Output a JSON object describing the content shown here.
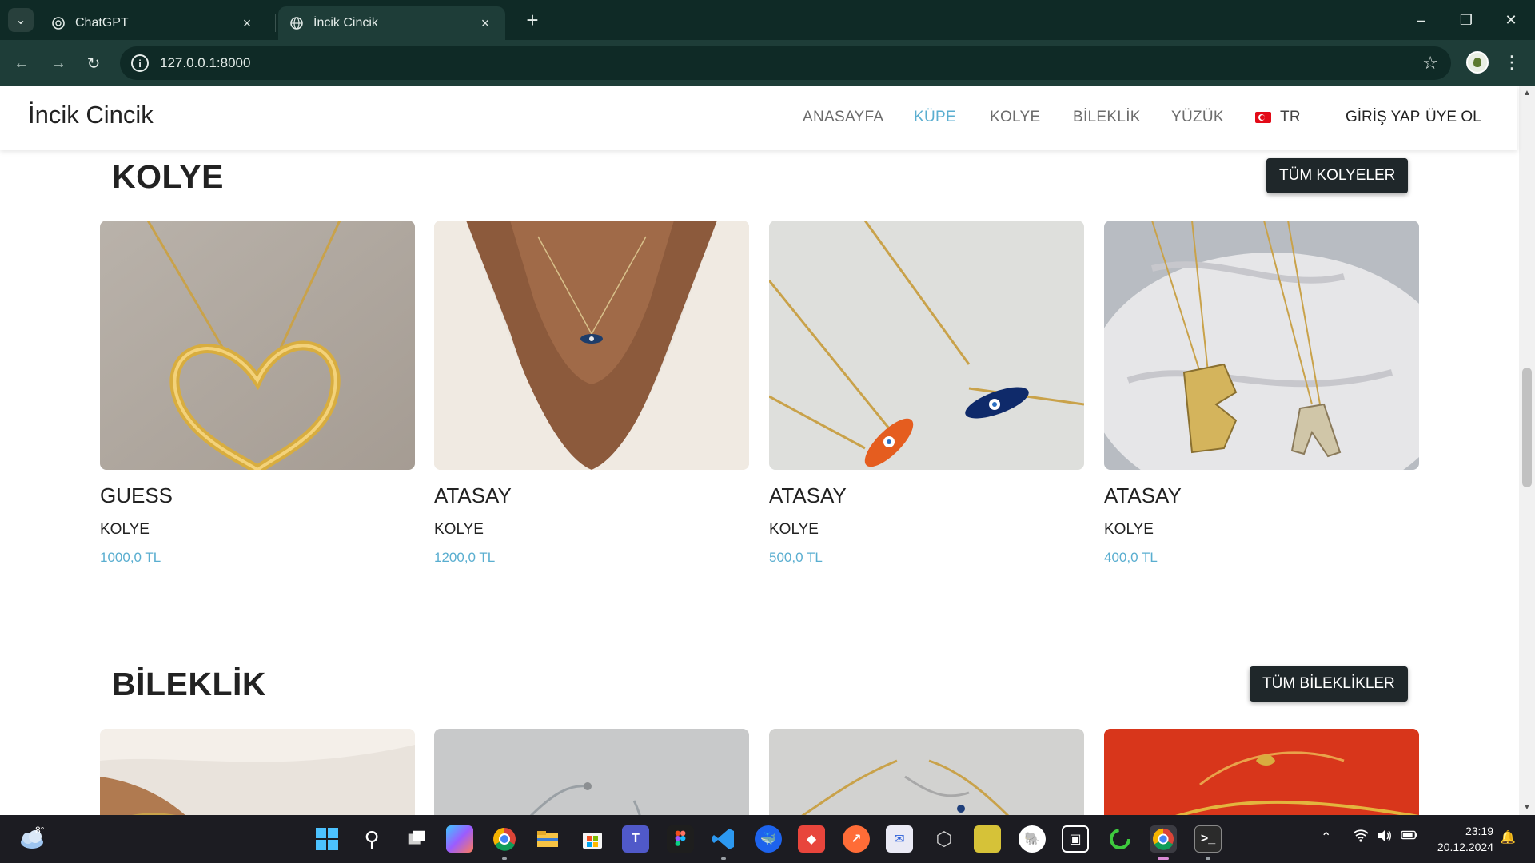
{
  "browser": {
    "tabs": [
      {
        "title": "ChatGPT",
        "active": false
      },
      {
        "title": "İncik Cincik",
        "active": true
      }
    ],
    "address": "127.0.0.1:8000"
  },
  "site": {
    "brand": "İncik Cincik",
    "nav": [
      "ANASAYFA",
      "KÜPE",
      "KOLYE",
      "BİLEKLİK",
      "YÜZÜK"
    ],
    "active_nav": "KÜPE",
    "language": "TR",
    "login": "GİRİŞ YAP",
    "register": "ÜYE OL"
  },
  "sections": [
    {
      "title": "KOLYE",
      "button": "TÜM KOLYELER",
      "products": [
        {
          "brand": "GUESS",
          "category": "KOLYE",
          "price": "1000,0 TL"
        },
        {
          "brand": "ATASAY",
          "category": "KOLYE",
          "price": "1200,0 TL"
        },
        {
          "brand": "ATASAY",
          "category": "KOLYE",
          "price": "500,0 TL"
        },
        {
          "brand": "ATASAY",
          "category": "KOLYE",
          "price": "400,0 TL"
        }
      ]
    },
    {
      "title": "BİLEKLİK",
      "button": "TÜM BİLEKLİKLER"
    }
  ],
  "taskbar": {
    "weather_temp": "8°",
    "time": "23:19",
    "date": "20.12.2024"
  }
}
